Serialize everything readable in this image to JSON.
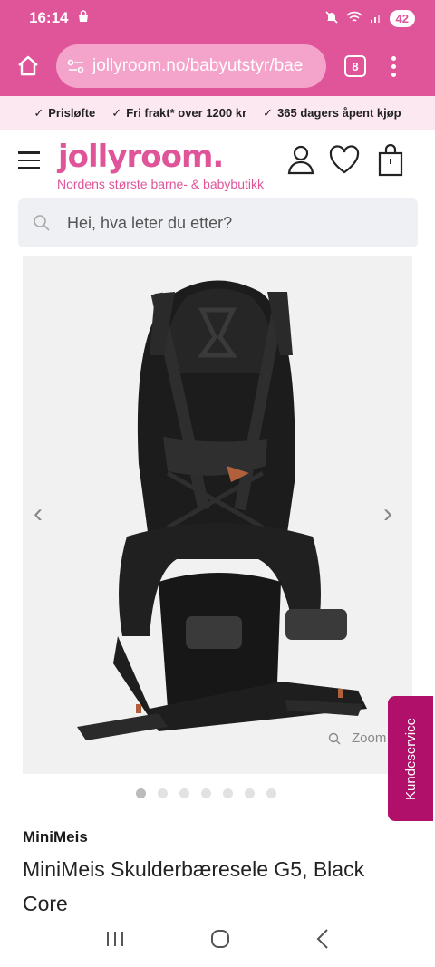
{
  "status_bar": {
    "time": "16:14",
    "battery": "42"
  },
  "browser": {
    "url": "jollyroom.no/babyutstyr/bae",
    "tab_count": "8"
  },
  "promo": {
    "items": [
      "Prisløfte",
      "Fri frakt* over 1200 kr",
      "365 dagers åpent kjøp"
    ]
  },
  "header": {
    "logo": "jollyroom.",
    "tagline": "Nordens største barne- & babybutikk"
  },
  "search": {
    "placeholder": "Hei, hva leter du etter?"
  },
  "gallery": {
    "zoom_label": "Zoom",
    "image_count": 7,
    "active_index": 0
  },
  "side_tab": {
    "label": "Kundeservice"
  },
  "product": {
    "brand": "MiniMeis",
    "title": "MiniMeis Skulderbæresele G5, Black Core"
  },
  "colors": {
    "brand_pink": "#e0559a",
    "promo_bg": "#fce8f1",
    "service_tab": "#b0106a"
  }
}
